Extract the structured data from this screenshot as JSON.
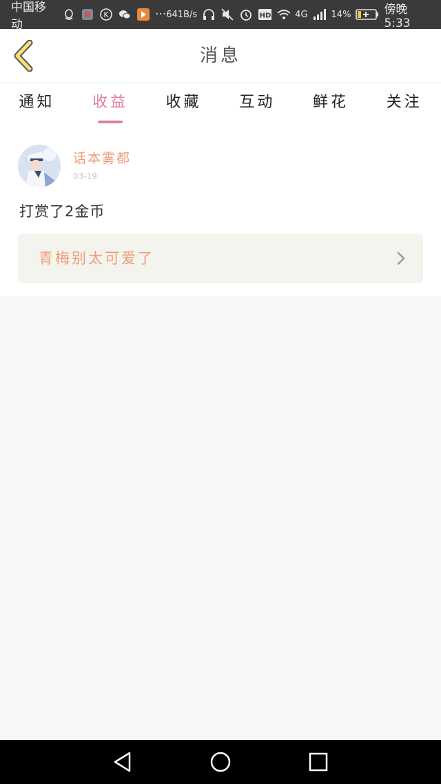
{
  "status_bar": {
    "carrier": "中国移动",
    "net_speed": "641B/s",
    "signal_type": "4G",
    "battery": "14%",
    "time": "傍晚5:33",
    "more": "···"
  },
  "header": {
    "title": "消息"
  },
  "tabs": [
    {
      "label": "通知",
      "active": false
    },
    {
      "label": "收益",
      "active": true
    },
    {
      "label": "收藏",
      "active": false
    },
    {
      "label": "互动",
      "active": false
    },
    {
      "label": "鲜花",
      "active": false
    },
    {
      "label": "关注",
      "active": false
    }
  ],
  "message": {
    "username": "话本雾都",
    "date": "03-19",
    "text": "打赏了2金币",
    "reference": "青梅别太可爱了"
  },
  "colors": {
    "accent": "#e07fa0",
    "username": "#ef9a74",
    "background": "#f8f6f7"
  },
  "icons": {
    "back": "chevron-left-icon",
    "ref": "chevron-right-icon",
    "nav": [
      "back-triangle-icon",
      "home-circle-icon",
      "recents-square-icon"
    ]
  }
}
